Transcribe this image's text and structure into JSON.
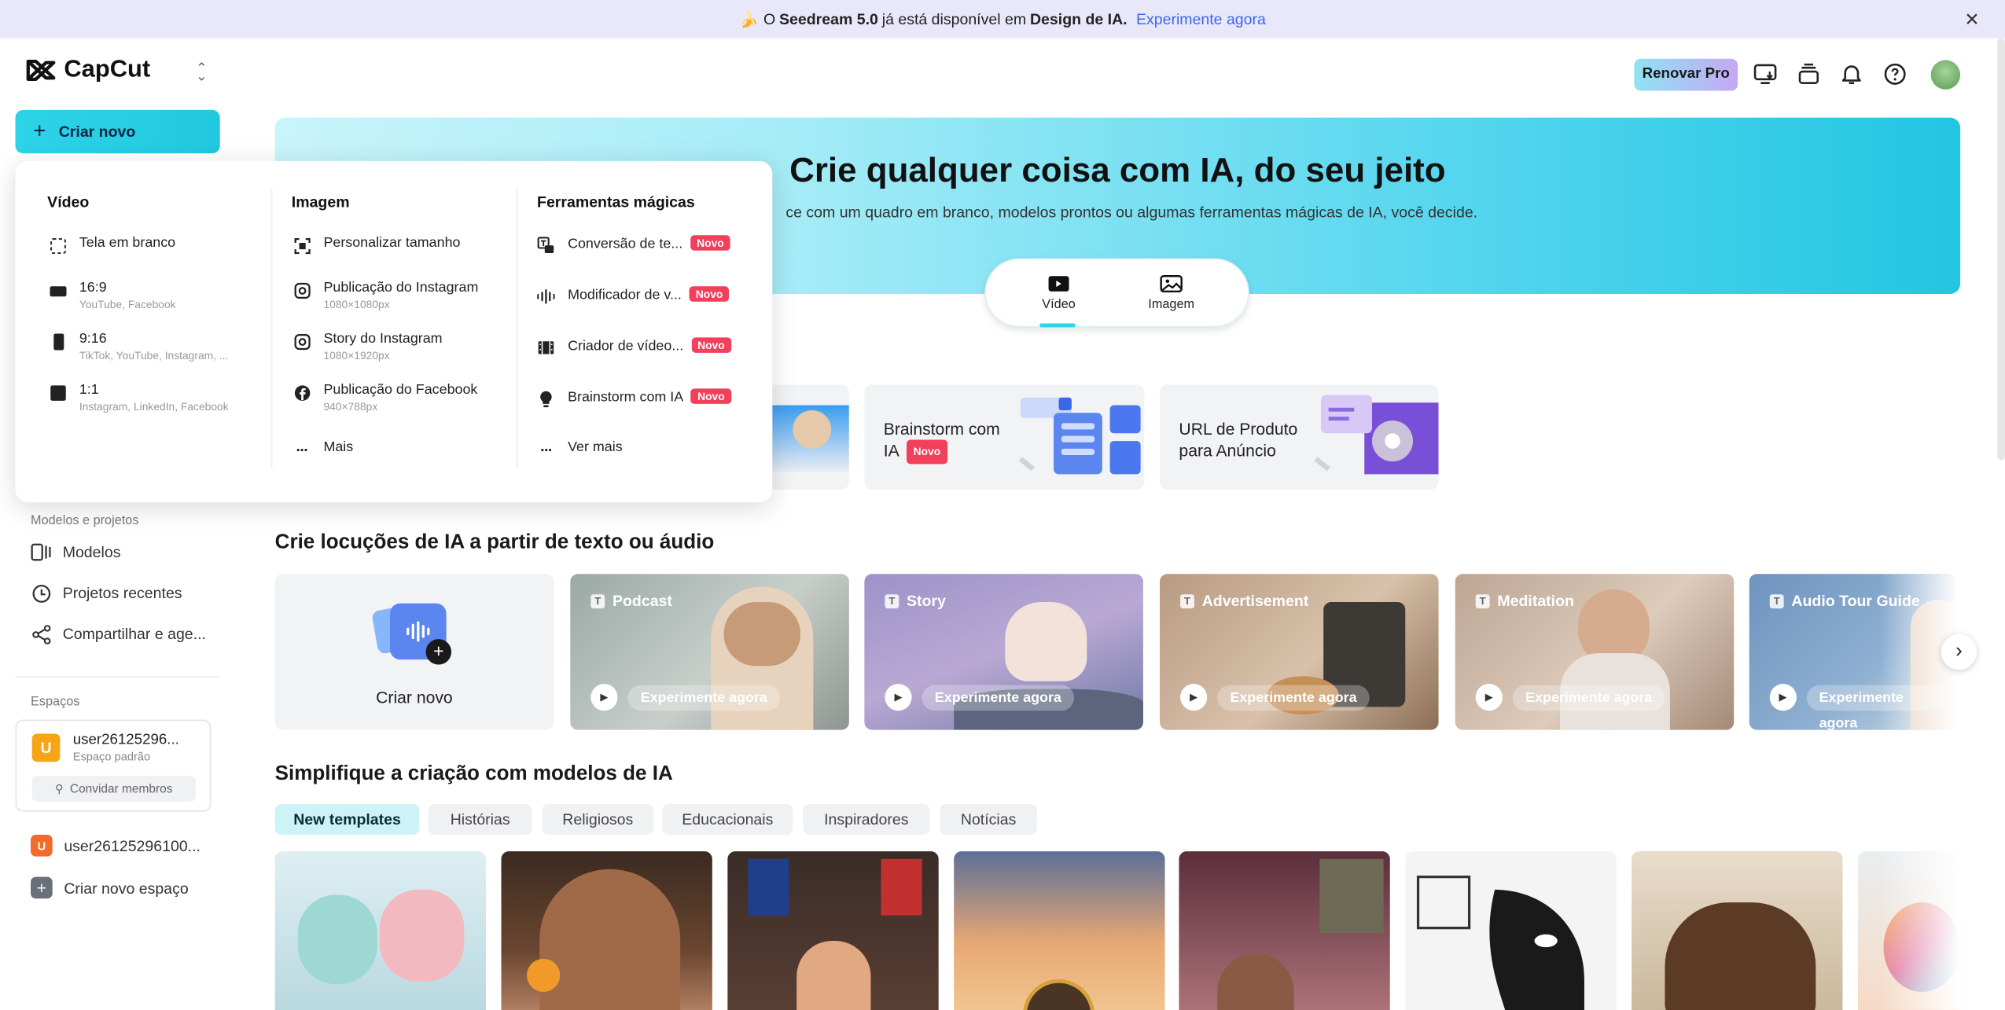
{
  "banner": {
    "emoji": "🍌",
    "prefix": "O",
    "strong1": "Seedream 5.0",
    "middle": "já está disponível em",
    "strong2": "Design de IA.",
    "link": "Experimente agora"
  },
  "app": {
    "name": "CapCut"
  },
  "header": {
    "renew": "Renovar Pro"
  },
  "sidebar": {
    "create": "Criar novo",
    "section_models": "Modelos e projetos",
    "items": [
      "Modelos",
      "Projetos recentes",
      "Compartilhar e age..."
    ],
    "section_spaces": "Espaços",
    "space_user": "user26125296...",
    "space_type": "Espaço padrão",
    "invite": "Convidar membros",
    "user_full": "user26125296100...",
    "new_space": "Criar novo espaço",
    "avatar_letter": "U"
  },
  "hero": {
    "title": "Crie qualquer coisa com IA, do seu jeito",
    "subtitle": "ce com um quadro em branco, modelos prontos ou algumas ferramentas mágicas de IA, você decide.",
    "tab_video": "Vídeo",
    "tab_image": "Imagem"
  },
  "feature_cards": [
    {
      "line1": "Brainstorm com",
      "line2": "IA",
      "badge": "Novo"
    },
    {
      "line1": "URL de Produto",
      "line2": "para Anúncio"
    }
  ],
  "voice": {
    "heading": "Crie locuções de IA a partir de texto ou áudio",
    "create": "Criar novo",
    "cards": [
      "Podcast",
      "Story",
      "Advertisement",
      "Meditation",
      "Audio Tour Guide"
    ],
    "try": "Experimente agora"
  },
  "templates": {
    "heading": "Simplifique a criação com modelos de IA",
    "chips": [
      "New templates",
      "Histórias",
      "Religiosos",
      "Educacionais",
      "Inspiradores",
      "Notícias"
    ]
  },
  "menu": {
    "video": {
      "title": "Vídeo",
      "items": [
        {
          "t": "Tela em branco",
          "s": ""
        },
        {
          "t": "16:9",
          "s": "YouTube, Facebook"
        },
        {
          "t": "9:16",
          "s": "TikTok, YouTube, Instagram, ..."
        },
        {
          "t": "1:1",
          "s": "Instagram, LinkedIn, Facebook"
        }
      ]
    },
    "image": {
      "title": "Imagem",
      "items": [
        {
          "t": "Personalizar tamanho",
          "s": ""
        },
        {
          "t": "Publicação do Instagram",
          "s": "1080×1080px"
        },
        {
          "t": "Story do Instagram",
          "s": "1080×1920px"
        },
        {
          "t": "Publicação do Facebook",
          "s": "940×788px"
        },
        {
          "t": "Mais",
          "s": ""
        }
      ]
    },
    "magic": {
      "title": "Ferramentas mágicas",
      "items": [
        {
          "t": "Conversão de te...",
          "badge": "Novo"
        },
        {
          "t": "Modificador de v...",
          "badge": "Novo"
        },
        {
          "t": "Criador de vídeo...",
          "badge": "Novo"
        },
        {
          "t": "Brainstorm com IA",
          "badge": "Novo"
        },
        {
          "t": "Ver mais",
          "badge": ""
        }
      ]
    }
  },
  "colors": {
    "accent": "#22c8e0",
    "badge": "#f23f5c",
    "link": "#3b66f5"
  }
}
